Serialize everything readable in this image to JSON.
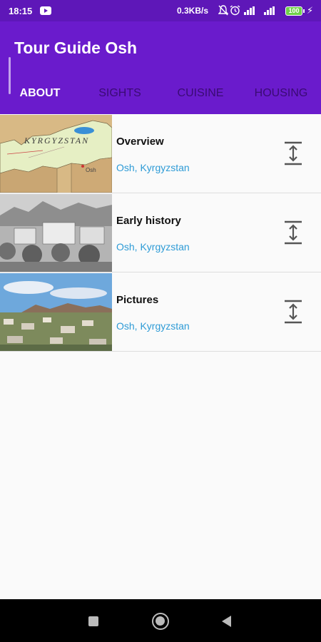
{
  "status_bar": {
    "time": "18:15",
    "net_speed": "0.3KB/s",
    "battery_level": "100",
    "icons": [
      "youtube-icon",
      "mute-icon",
      "alarm-icon",
      "signal-icon",
      "signal-4g-icon",
      "battery-icon",
      "charging-icon"
    ]
  },
  "app": {
    "title": "Tour Guide Osh",
    "accent_color": "#6a1bcc",
    "status_bar_color": "#5e17b8",
    "link_color": "#2e9bd6"
  },
  "tabs": [
    {
      "label": "ABOUT",
      "selected": true
    },
    {
      "label": "SIGHTS",
      "selected": false
    },
    {
      "label": "CUISINE",
      "selected": false
    },
    {
      "label": "HOUSING",
      "selected": false
    }
  ],
  "items": [
    {
      "title": "Overview",
      "subtitle": "Osh, Kyrgyzstan",
      "thumbnail": "map-of-kyrgyzstan",
      "map_text": "KYRGYZSTAN",
      "map_city": "Osh"
    },
    {
      "title": "Early history",
      "subtitle": "Osh, Kyrgyzstan",
      "thumbnail": "historic-photo"
    },
    {
      "title": "Pictures",
      "subtitle": "Osh, Kyrgyzstan",
      "thumbnail": "city-panorama"
    }
  ],
  "nav_bar": {
    "icons": [
      "recent-apps-icon",
      "home-icon",
      "back-icon"
    ]
  }
}
